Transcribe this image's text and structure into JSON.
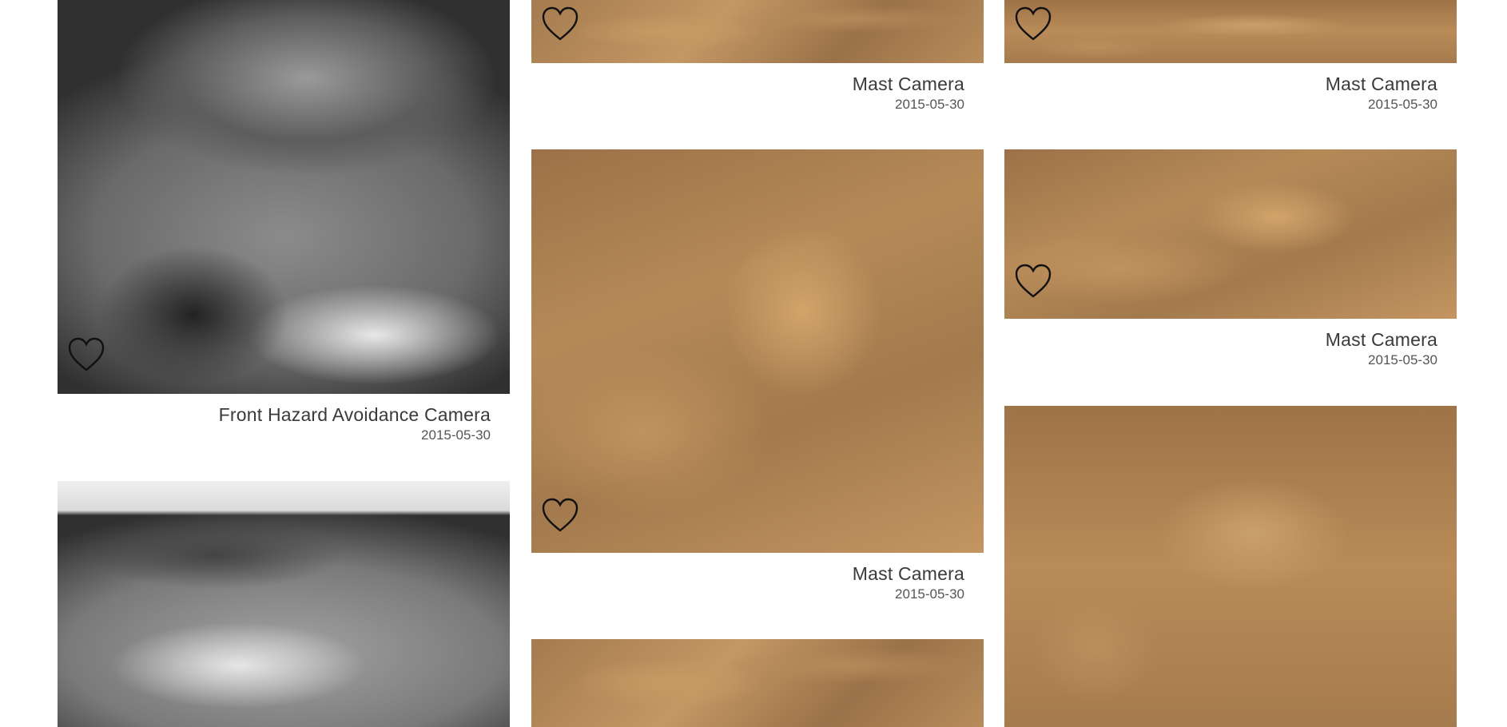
{
  "gallery": {
    "cards": [
      {
        "camera": "Front Hazard Avoidance Camera",
        "date": "2015-05-30"
      },
      {
        "camera": "Mast Camera",
        "date": "2015-05-30"
      },
      {
        "camera": "Mast Camera",
        "date": "2015-05-30"
      },
      {
        "camera": "Mast Camera",
        "date": "2015-05-30"
      },
      {
        "camera": "Mast Camera",
        "date": "2015-05-30"
      }
    ]
  },
  "icons": {
    "favorite": "heart-outline-icon"
  },
  "colors": {
    "caption_text": "#3a3a3a",
    "date_text": "#555555",
    "heart_stroke": "#111111"
  }
}
